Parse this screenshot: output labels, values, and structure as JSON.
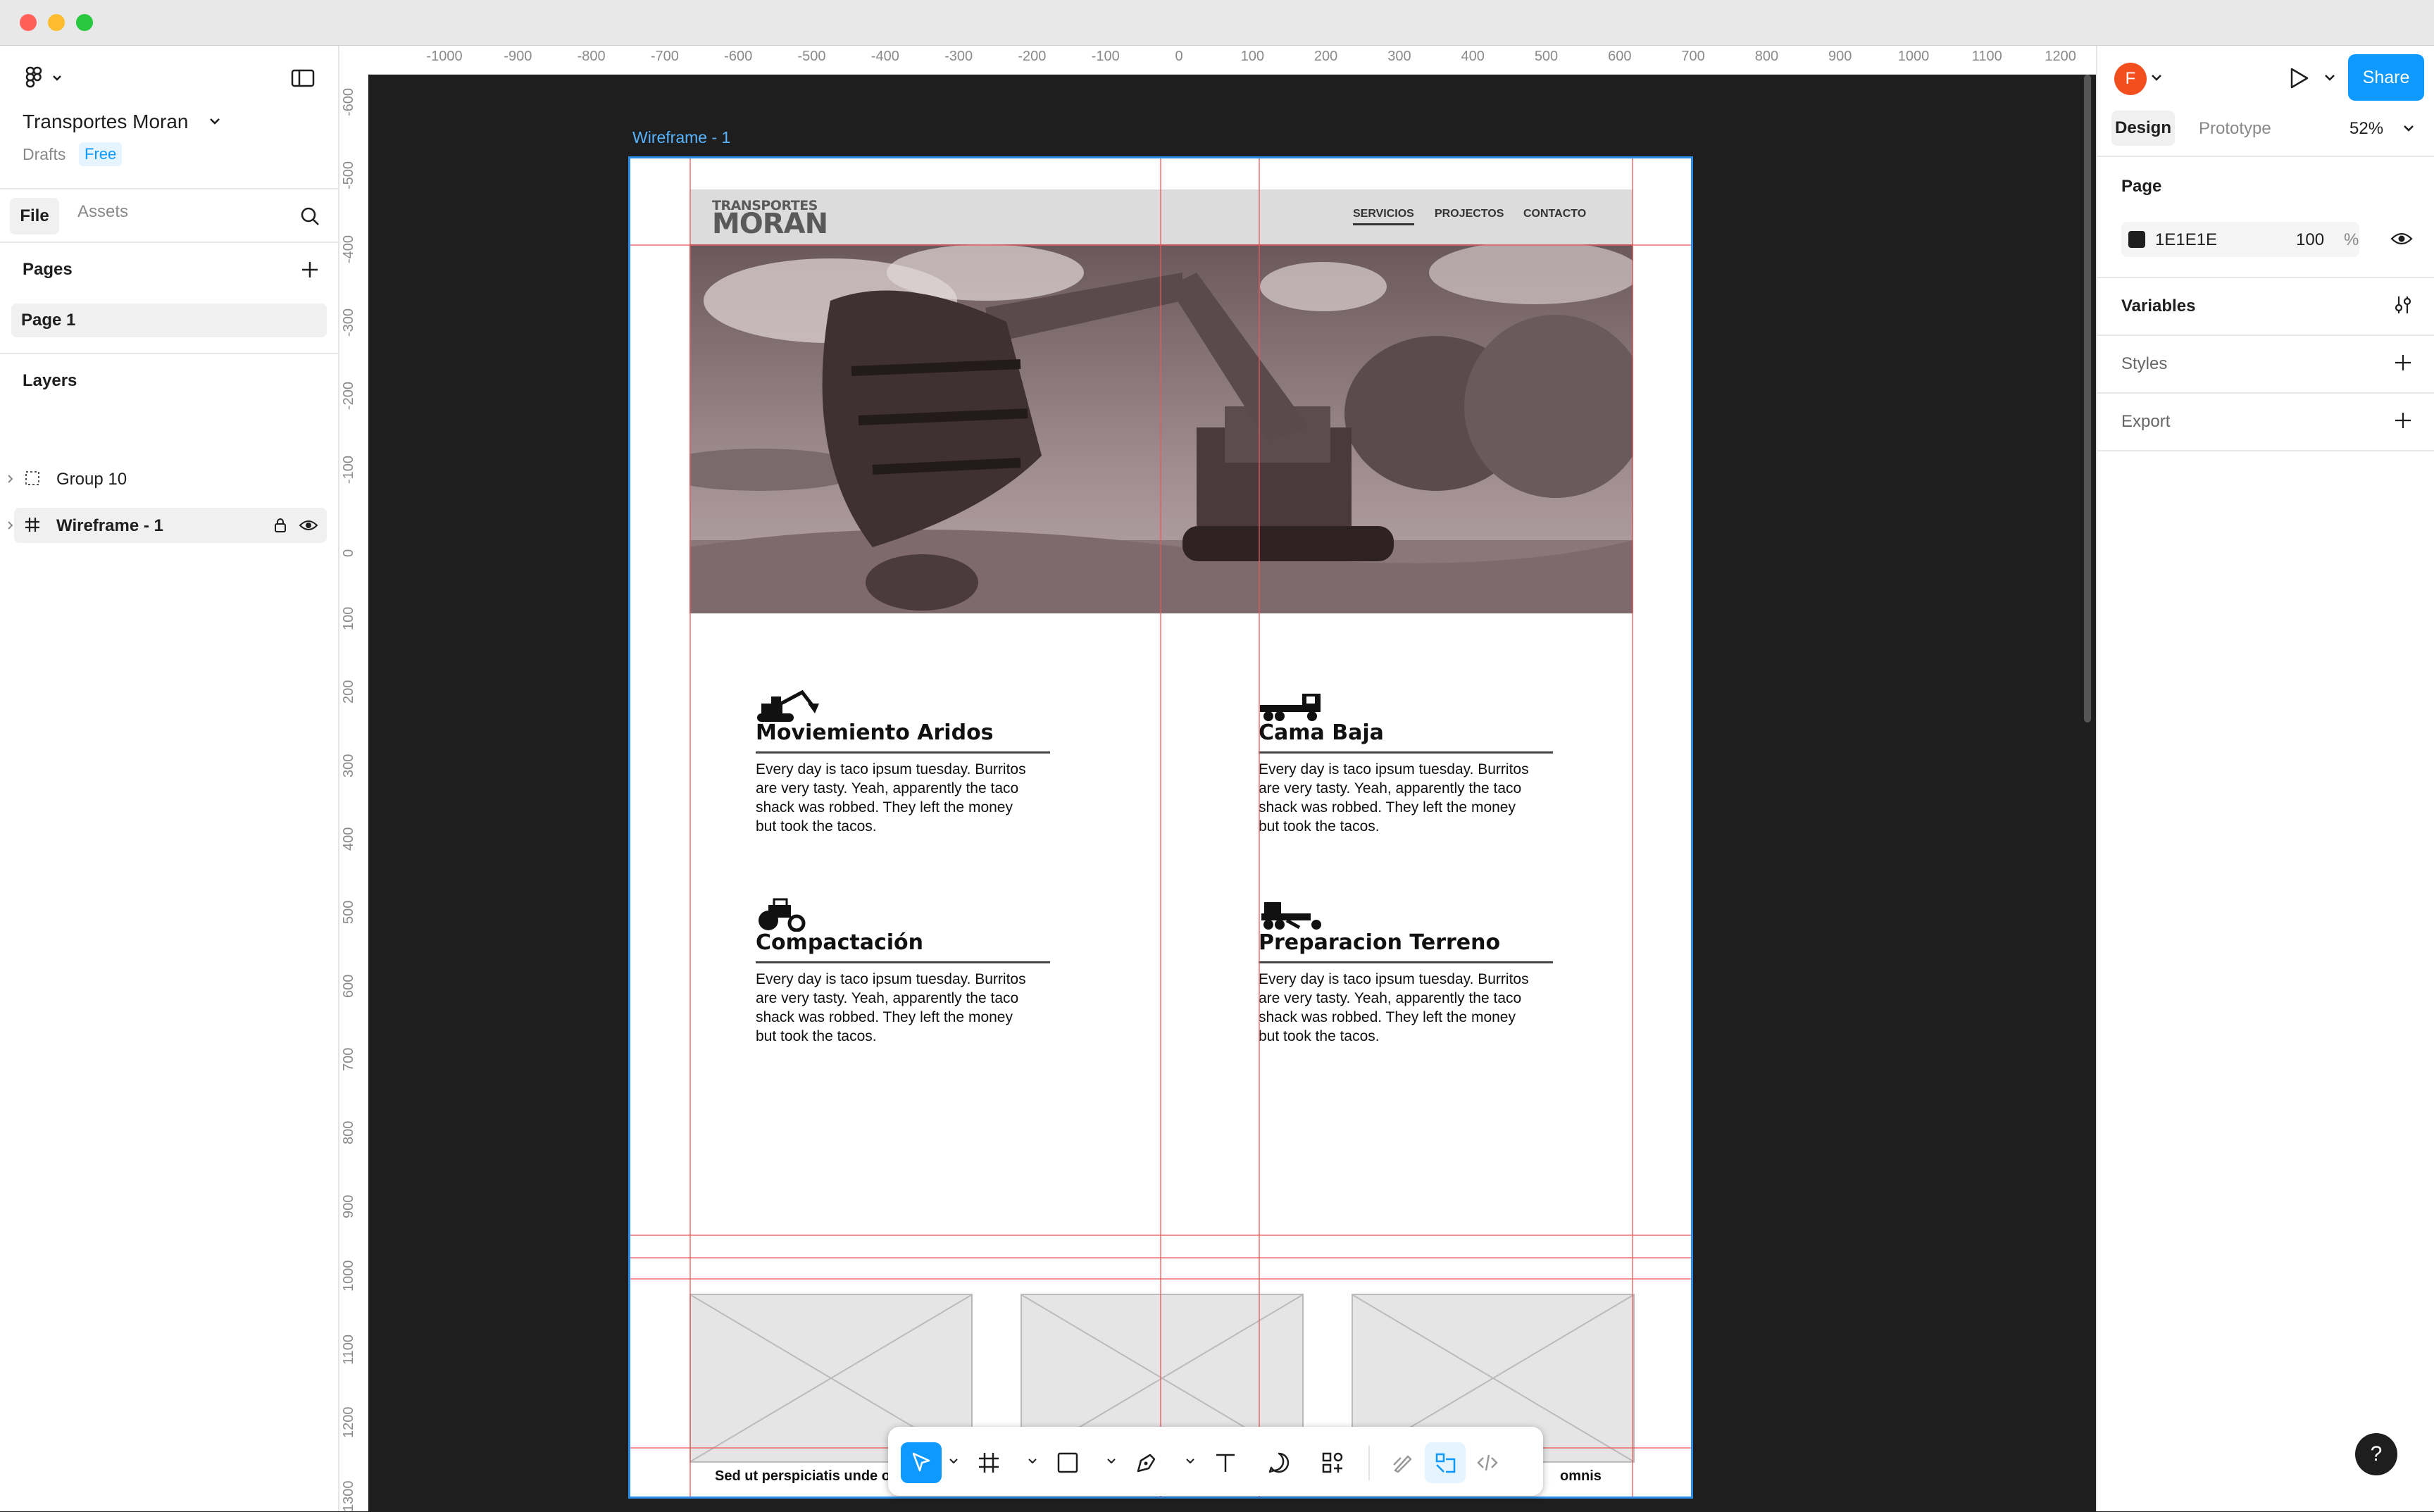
{
  "file": {
    "name": "Transportes Moran",
    "location": "Drafts",
    "plan": "Free"
  },
  "left_tabs": {
    "file": "File",
    "assets": "Assets"
  },
  "pages": {
    "header": "Pages",
    "items": [
      "Page 1"
    ]
  },
  "layers": {
    "header": "Layers",
    "items": [
      "Group 10",
      "Wireframe - 1"
    ]
  },
  "user_initial": "F",
  "share_label": "Share",
  "right_tabs": {
    "design": "Design",
    "prototype": "Prototype",
    "zoom": "52%"
  },
  "page_props": {
    "header": "Page",
    "color": "1E1E1E",
    "opacity": "100",
    "unit": "%"
  },
  "sections": {
    "variables": "Variables",
    "styles": "Styles",
    "export": "Export"
  },
  "help_label": "?",
  "ruler_top": [
    "-1000",
    "-900",
    "-800",
    "-700",
    "-600",
    "-500",
    "-400",
    "-300",
    "-200",
    "-100",
    "0",
    "100",
    "200",
    "300",
    "400",
    "500",
    "600",
    "700",
    "800",
    "900",
    "1000",
    "1100",
    "1200"
  ],
  "ruler_left": [
    "-600",
    "-500",
    "-400",
    "-300",
    "-200",
    "-100",
    "0",
    "100",
    "200",
    "300",
    "400",
    "500",
    "600",
    "700",
    "800",
    "900",
    "1000",
    "1100",
    "1200",
    "1300"
  ],
  "frame_label": "Wireframe - 1",
  "site": {
    "logo_top": "TRANSPORTES",
    "logo_bottom": "MORAN",
    "nav": [
      "SERVICIOS",
      "PROJECTOS",
      "CONTACTO"
    ],
    "services": [
      {
        "title": "Moviemiento Aridos",
        "text": [
          "Every day is taco ipsum tuesday. Burritos",
          "are very tasty. Yeah, apparently the taco",
          "shack was robbed. They left the money",
          "but took the tacos."
        ]
      },
      {
        "title": "Cama Baja",
        "text": [
          "Every day is taco ipsum tuesday. Burritos",
          "are very tasty. Yeah, apparently the taco",
          "shack was robbed. They left the money",
          "but took the tacos."
        ]
      },
      {
        "title": "Compactación",
        "text": [
          "Every day is taco ipsum tuesday. Burritos",
          "are very tasty. Yeah, apparently the taco",
          "shack was robbed. They left the money",
          "but took the tacos."
        ]
      },
      {
        "title": "Preparacion Terreno",
        "text": [
          "Every day is taco ipsum tuesday. Burritos",
          "are very tasty. Yeah, apparently the taco",
          "shack was robbed. They left the money",
          "but took the tacos."
        ]
      }
    ],
    "card_left_title": "Sed ut perspiciatis unde o",
    "card_right_title": "omnis"
  },
  "toolbar_tools": [
    "move-icon",
    "frame-icon",
    "rectangle-icon",
    "pen-icon",
    "text-icon",
    "comment-icon",
    "components-icon",
    "draw-icon",
    "dev-icon",
    "code-icon"
  ],
  "colors": {
    "accent": "#0d99ff",
    "canvas": "#1e1e1e",
    "guide": "#eb5757",
    "frame_outline": "#2a8ce6",
    "avatar": "#f24e1e"
  }
}
